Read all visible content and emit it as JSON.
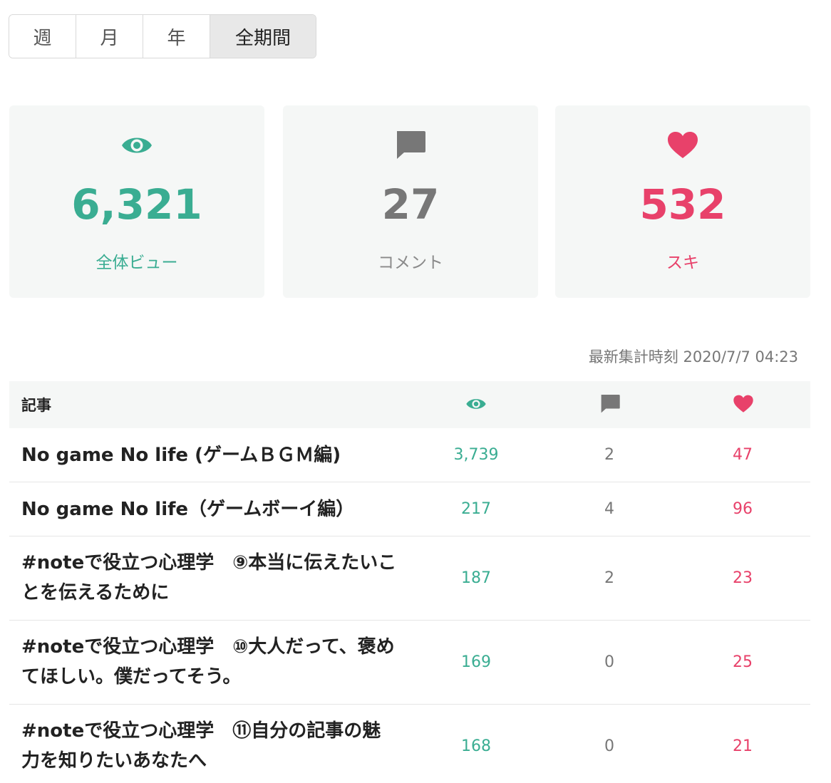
{
  "tabs": [
    {
      "label": "週",
      "active": false
    },
    {
      "label": "月",
      "active": false
    },
    {
      "label": "年",
      "active": false
    },
    {
      "label": "全期間",
      "active": true
    }
  ],
  "stats": {
    "views": {
      "value": "6,321",
      "label": "全体ビュー",
      "icon": "eye-icon",
      "color": "#3aad92"
    },
    "comments": {
      "value": "27",
      "label": "コメント",
      "icon": "comment-icon",
      "color": "#777777"
    },
    "likes": {
      "value": "532",
      "label": "スキ",
      "icon": "heart-icon",
      "color": "#e8416a"
    }
  },
  "updated": "最新集計時刻 2020/7/7 04:23",
  "table": {
    "header_article": "記事",
    "rows": [
      {
        "title": "No game No life (ゲームＢＧＭ編)",
        "views": "3,739",
        "comments": "2",
        "likes": "47"
      },
      {
        "title": "No game No life（ゲームボーイ編）",
        "views": "217",
        "comments": "4",
        "likes": "96"
      },
      {
        "title": "#noteで役立つ心理学　⑨本当に伝えたいことを伝えるために",
        "views": "187",
        "comments": "2",
        "likes": "23"
      },
      {
        "title": "#noteで役立つ心理学　⑩大人だって、褒めてほしい。僕だってそう。",
        "views": "169",
        "comments": "0",
        "likes": "25"
      },
      {
        "title": "#noteで役立つ心理学　⑪自分の記事の魅力を知りたいあなたへ",
        "views": "168",
        "comments": "0",
        "likes": "21"
      }
    ]
  }
}
